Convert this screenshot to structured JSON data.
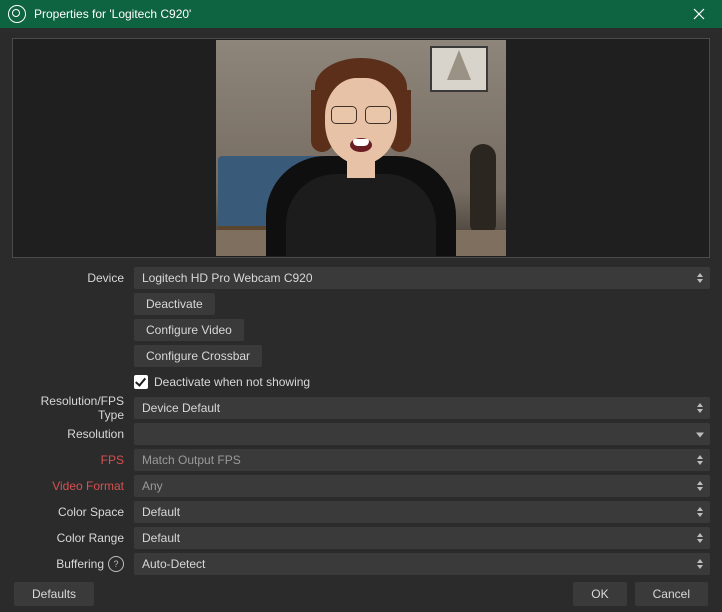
{
  "titlebar": {
    "title": "Properties for 'Logitech C920'"
  },
  "form": {
    "device": {
      "label": "Device",
      "value": "Logitech HD Pro Webcam C920"
    },
    "deactivate_btn": "Deactivate",
    "configure_video_btn": "Configure Video",
    "configure_crossbar_btn": "Configure Crossbar",
    "deactivate_when_not_showing": {
      "label": "Deactivate when not showing",
      "checked": true
    },
    "resolution_fps_type": {
      "label": "Resolution/FPS Type",
      "value": "Device Default"
    },
    "resolution": {
      "label": "Resolution",
      "value": ""
    },
    "fps": {
      "label": "FPS",
      "value": "Match Output FPS"
    },
    "video_format": {
      "label": "Video Format",
      "value": "Any"
    },
    "color_space": {
      "label": "Color Space",
      "value": "Default"
    },
    "color_range": {
      "label": "Color Range",
      "value": "Default"
    },
    "buffering": {
      "label": "Buffering",
      "value": "Auto-Detect"
    }
  },
  "footer": {
    "defaults": "Defaults",
    "ok": "OK",
    "cancel": "Cancel"
  }
}
